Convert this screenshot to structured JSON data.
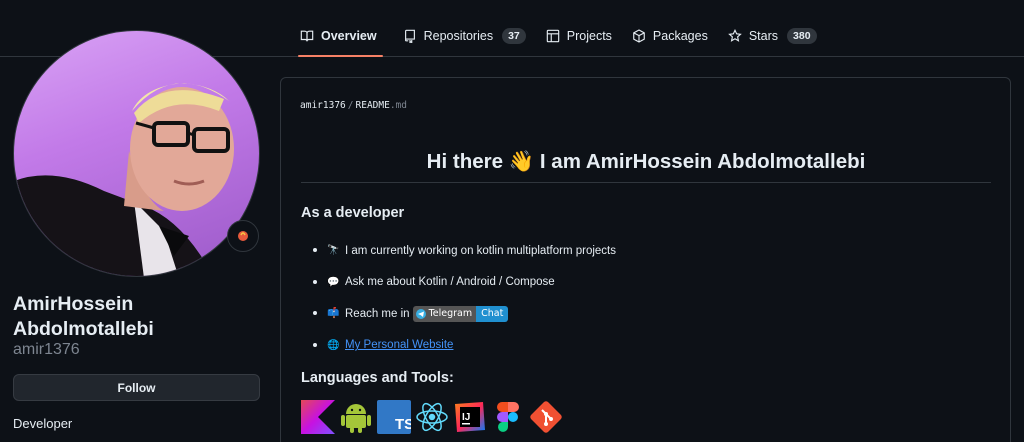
{
  "nav": {
    "tabs": [
      {
        "label": "Overview",
        "icon": "book-icon",
        "active": true
      },
      {
        "label": "Repositories",
        "icon": "repo-icon",
        "count": "37"
      },
      {
        "label": "Projects",
        "icon": "table-icon"
      },
      {
        "label": "Packages",
        "icon": "package-icon"
      },
      {
        "label": "Stars",
        "icon": "star-icon",
        "count": "380"
      }
    ]
  },
  "profile": {
    "display_name": "AmirHossein Abdolmotallebi",
    "login": "amir1376",
    "follow_label": "Follow",
    "bio": "Developer"
  },
  "readme": {
    "owner": "amir1376",
    "separator": "/",
    "file": "README",
    "ext": ".md",
    "greeting": "Hi there 👋 I am AmirHossein Abdolmotallebi",
    "heading_dev": "As a developer",
    "items": [
      {
        "emoji": "🔭",
        "text": "I am currently working on kotlin multiplatform projects"
      },
      {
        "emoji": "💬",
        "text": "Ask me about Kotlin / Android / Compose"
      },
      {
        "emoji": "📫",
        "text": "Reach me in",
        "badge_left": "Telegram",
        "badge_right": "Chat"
      },
      {
        "emoji": "🌐",
        "link": "My Personal Website"
      }
    ],
    "heading_tools": "Languages and Tools:",
    "tools": [
      "kotlin-icon",
      "android-icon",
      "typescript-icon",
      "react-icon",
      "intellij-icon",
      "figma-icon",
      "git-icon"
    ],
    "ts_label": "TS",
    "ij_label": "IJ"
  },
  "colors": {
    "accent_underline": "#f78166",
    "link": "#4493f8",
    "background": "#0d1117",
    "border": "#30363d"
  }
}
